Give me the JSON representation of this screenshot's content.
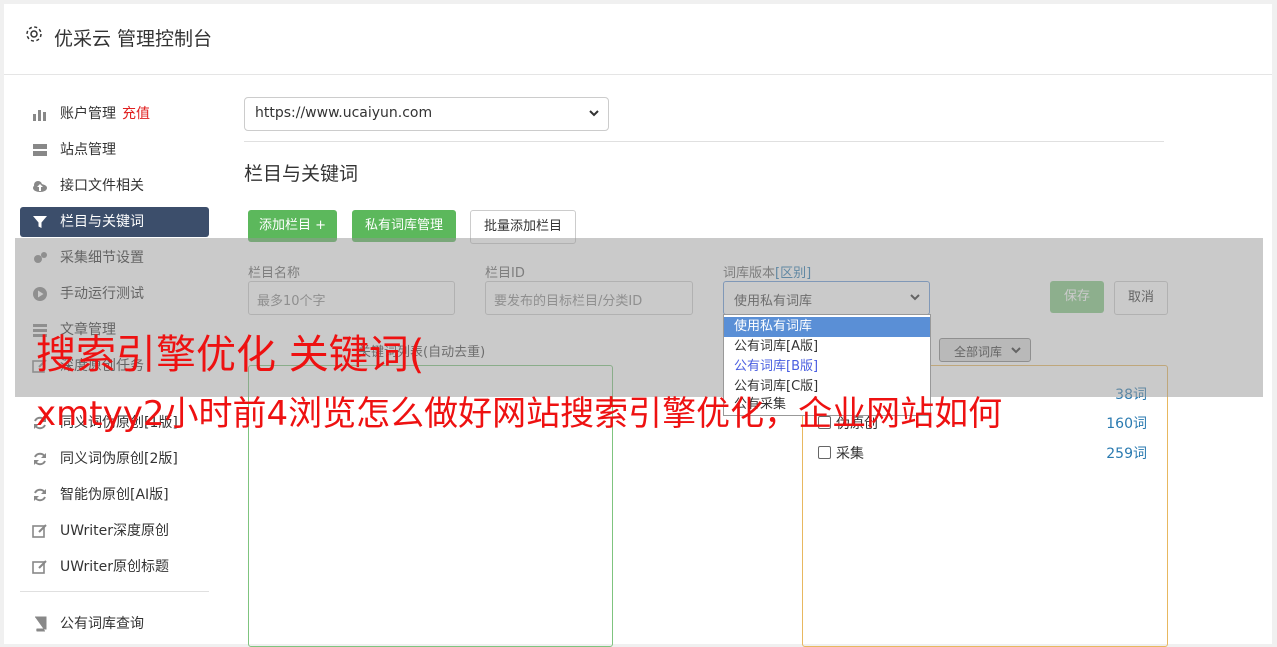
{
  "header": {
    "title": "优采云 管理控制台"
  },
  "sidebar": {
    "items": [
      {
        "label": "账户管理",
        "extra": "充值"
      },
      {
        "label": "站点管理"
      },
      {
        "label": "接口文件相关"
      },
      {
        "label": "栏目与关键词"
      },
      {
        "label": "采集细节设置"
      },
      {
        "label": "手动运行测试"
      },
      {
        "label": "文章管理"
      },
      {
        "label": "深度原创任务"
      },
      {
        "label": "同义词伪原创[1版]"
      },
      {
        "label": "同义词伪原创[2版]"
      },
      {
        "label": "智能伪原创[AI版]"
      },
      {
        "label": "UWriter深度原创"
      },
      {
        "label": "UWriter原创标题"
      },
      {
        "label": "公有词库查询"
      }
    ]
  },
  "site_select": {
    "value": "https://www.ucaiyun.com"
  },
  "section": {
    "title": "栏目与关键词"
  },
  "buttons": {
    "add_column": "添加栏目 +",
    "private_lib": "私有词库管理",
    "batch_add": "批量添加栏目",
    "save": "保存",
    "cancel": "取消"
  },
  "form": {
    "name_label": "栏目名称",
    "name_placeholder": "最多10个字",
    "id_label": "栏目ID",
    "id_placeholder": "要发布的目标栏目/分类ID",
    "version_label": "词库版本",
    "version_link": "[区别]",
    "version_value": "使用私有词库",
    "version_options": [
      "使用私有词库",
      "公有词库[A版]",
      "公有词库[B版]",
      "公有词库[C版]",
      "公有采集"
    ]
  },
  "list": {
    "label": "关键词列表(自动去重)",
    "filter_value": "全部词库"
  },
  "libraries": [
    {
      "name": "",
      "count": "38词"
    },
    {
      "name": "伪原创",
      "count": "160词"
    },
    {
      "name": "采集",
      "count": "259词"
    }
  ],
  "watermark": {
    "line1": "搜索引擎优化 关键词(",
    "line2": "xmtyy2小时前4浏览怎么做好网站搜索引擎优化，企业网站如何"
  },
  "colors": {
    "accent_green": "#5cb85c",
    "active_nav": "#3c4e6b",
    "link": "#2a7ab0",
    "watermark": "#ee1111"
  }
}
